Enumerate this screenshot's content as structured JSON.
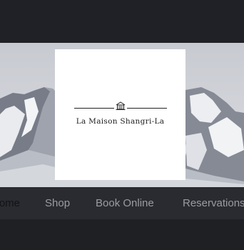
{
  "logo": {
    "text": "La Maison Shangri-La"
  },
  "nav": {
    "items": [
      {
        "label": "Home",
        "active": true
      },
      {
        "label": "Shop",
        "active": false
      },
      {
        "label": "Book Online",
        "active": false
      },
      {
        "label": "Reservations",
        "active": false
      }
    ]
  },
  "colors": {
    "background": "#1f2024",
    "nav_background": "#2a2b30",
    "nav_text": "#9a9ca3",
    "nav_active_text": "#121317",
    "logo_card": "#ffffff"
  }
}
